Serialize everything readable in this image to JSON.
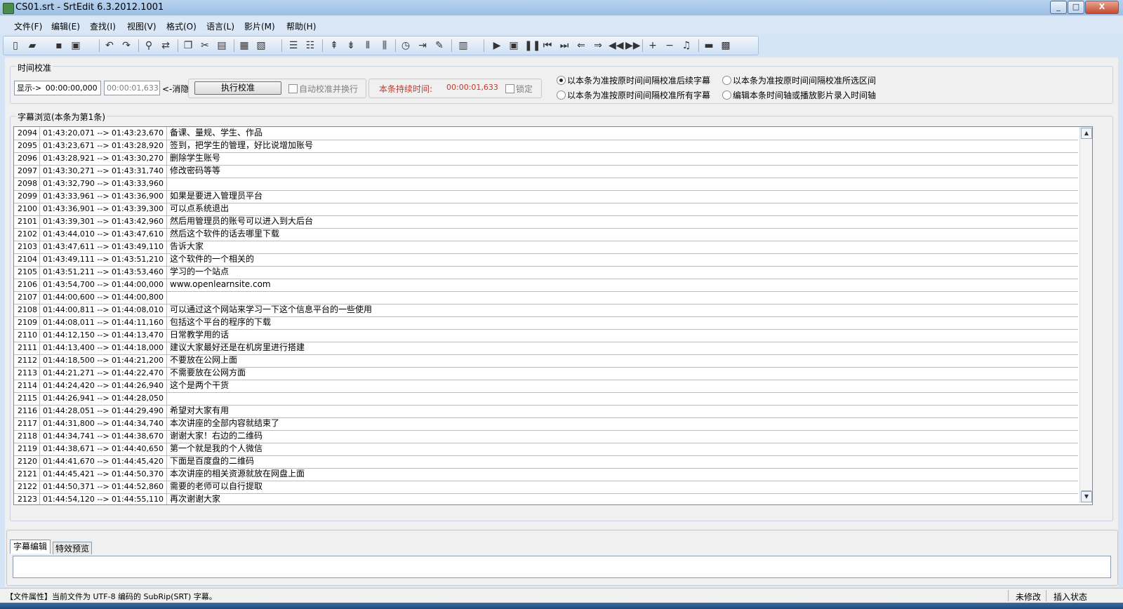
{
  "window": {
    "title": "CS01.srt - SrtEdit 6.3.2012.1001",
    "minimize": "_",
    "maximize": "□",
    "close": "X"
  },
  "menu": [
    {
      "label": "文件(F)"
    },
    {
      "label": "编辑(E)"
    },
    {
      "label": "查找(I)"
    },
    {
      "label": "视图(V)"
    },
    {
      "label": "格式(O)"
    },
    {
      "label": "语言(L)"
    },
    {
      "label": "影片(M)"
    },
    {
      "label": "帮助(H)"
    }
  ],
  "toolbar": {
    "icons": [
      "new-file-icon",
      "open-folder-icon",
      "save-icon",
      "save-as-icon",
      "undo-icon",
      "redo-icon",
      "find-icon",
      "replace-icon",
      "copy-icon",
      "cut-icon",
      "paste-icon",
      "open-sub-icon",
      "merge-icon",
      "align-left-icon",
      "align-right-icon",
      "insert-before-icon",
      "insert-after-icon",
      "split-icon",
      "join-icon",
      "timing-icon",
      "jump-icon",
      "edit-pen-icon",
      "preview-icon",
      "play-icon",
      "stop-icon",
      "pause-icon",
      "first-icon",
      "last-icon",
      "prev-icon",
      "next-icon",
      "rewind-icon",
      "forward-icon",
      "plus-icon",
      "minus-icon",
      "music-icon",
      "film-icon",
      "capture-icon"
    ]
  },
  "timing": {
    "group_title": "时间校准",
    "show_label": "显示->",
    "time_value": "00:00:00,000",
    "time_placeholder": "00:00:01,633",
    "cancel_label": "<-消隐",
    "execute_button": "执行校准",
    "auto_check_label": "自动校准并换行",
    "duration_label": "本条持续时间:",
    "duration_value": "00:00:01,633",
    "lock_label": "锁定",
    "radio1": "以本条为准按原时间间隔校准后续字幕",
    "radio2": "以本条为准按原时间间隔校准所选区间",
    "radio3": "以本条为准按原时间间隔校准所有字幕",
    "radio4": "编辑本条时间轴或播放影片录入时间轴"
  },
  "browse": {
    "group_title": "字幕浏览(本条为第1条)",
    "rows": [
      {
        "num": "2094",
        "time": "01:43:20,071 --> 01:43:23,670",
        "text": "备课、量规、学生、作品"
      },
      {
        "num": "2095",
        "time": "01:43:23,671 --> 01:43:28,920",
        "text": "签到，把学生的管理，好比说增加账号"
      },
      {
        "num": "2096",
        "time": "01:43:28,921 --> 01:43:30,270",
        "text": "删除学生账号"
      },
      {
        "num": "2097",
        "time": "01:43:30,271 --> 01:43:31,740",
        "text": "修改密码等等"
      },
      {
        "num": "2098",
        "time": "01:43:32,790 --> 01:43:33,960",
        "text": ""
      },
      {
        "num": "2099",
        "time": "01:43:33,961 --> 01:43:36,900",
        "text": "如果是要进入管理员平台"
      },
      {
        "num": "2100",
        "time": "01:43:36,901 --> 01:43:39,300",
        "text": "可以点系统退出"
      },
      {
        "num": "2101",
        "time": "01:43:39,301 --> 01:43:42,960",
        "text": "然后用管理员的账号可以进入到大后台"
      },
      {
        "num": "2102",
        "time": "01:43:44,010 --> 01:43:47,610",
        "text": "然后这个软件的话去哪里下载"
      },
      {
        "num": "2103",
        "time": "01:43:47,611 --> 01:43:49,110",
        "text": "告诉大家"
      },
      {
        "num": "2104",
        "time": "01:43:49,111 --> 01:43:51,210",
        "text": "这个软件的一个相关的"
      },
      {
        "num": "2105",
        "time": "01:43:51,211 --> 01:43:53,460",
        "text": "学习的一个站点"
      },
      {
        "num": "2106",
        "time": "01:43:54,700 --> 01:44:00,000",
        "text": "www.openlearnsite.com"
      },
      {
        "num": "2107",
        "time": "01:44:00,600 --> 01:44:00,800",
        "text": ""
      },
      {
        "num": "2108",
        "time": "01:44:00,811 --> 01:44:08,010",
        "text": "可以通过这个网站来学习一下这个信息平台的一些使用"
      },
      {
        "num": "2109",
        "time": "01:44:08,011 --> 01:44:11,160",
        "text": "包括这个平台的程序的下载"
      },
      {
        "num": "2110",
        "time": "01:44:12,150 --> 01:44:13,470",
        "text": "日常教学用的话"
      },
      {
        "num": "2111",
        "time": "01:44:13,400 --> 01:44:18,000",
        "text": "建议大家最好还是在机房里进行搭建"
      },
      {
        "num": "2112",
        "time": "01:44:18,500 --> 01:44:21,200",
        "text": "不要放在公网上面"
      },
      {
        "num": "2113",
        "time": "01:44:21,271 --> 01:44:22,470",
        "text": "不需要放在公网方面"
      },
      {
        "num": "2114",
        "time": "01:44:24,420 --> 01:44:26,940",
        "text": "这个是两个干货"
      },
      {
        "num": "2115",
        "time": "01:44:26,941 --> 01:44:28,050",
        "text": ""
      },
      {
        "num": "2116",
        "time": "01:44:28,051 --> 01:44:29,490",
        "text": "希望对大家有用"
      },
      {
        "num": "2117",
        "time": "01:44:31,800 --> 01:44:34,740",
        "text": "本次讲座的全部内容就结束了"
      },
      {
        "num": "2118",
        "time": "01:44:34,741 --> 01:44:38,670",
        "text": "谢谢大家！右边的二维码"
      },
      {
        "num": "2119",
        "time": "01:44:38,671 --> 01:44:40,650",
        "text": "第一个就是我的个人微信"
      },
      {
        "num": "2120",
        "time": "01:44:41,670 --> 01:44:45,420",
        "text": "下面是百度盘的二维码"
      },
      {
        "num": "2121",
        "time": "01:44:45,421 --> 01:44:50,370",
        "text": "本次讲座的相关资源就放在网盘上面"
      },
      {
        "num": "2122",
        "time": "01:44:50,371 --> 01:44:52,860",
        "text": "需要的老师可以自行提取"
      },
      {
        "num": "2123",
        "time": "01:44:54,120 --> 01:44:55,110",
        "text": "再次谢谢大家"
      }
    ]
  },
  "tabs": [
    {
      "label": "字幕编辑"
    },
    {
      "label": "特效预览"
    }
  ],
  "status": {
    "file_info": "【文件属性】当前文件为 UTF-8 编码的 SubRip(SRT) 字幕。",
    "modified": "未修改",
    "mode": "插入状态"
  }
}
